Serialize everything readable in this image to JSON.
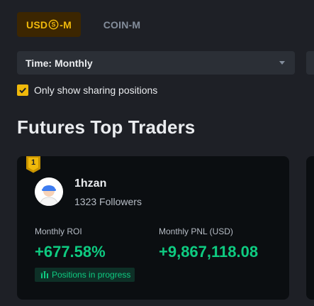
{
  "tabs": [
    {
      "label_prefix": "USD",
      "label_suffix": "-M",
      "icon": "dollar-coin-icon",
      "active": true
    },
    {
      "label": "COIN-M",
      "active": false
    }
  ],
  "filter": {
    "select_value": "Time: Monthly",
    "checkbox_label": "Only show sharing positions",
    "checkbox_checked": true
  },
  "page_title": "Futures Top Traders",
  "card": {
    "rank": "1",
    "name": "1hzan",
    "followers": "1323 Followers",
    "roi_label": "Monthly ROI",
    "roi_value": "+677.58%",
    "pnl_label": "Monthly PNL (USD)",
    "pnl_value": "+9,867,118.08",
    "status": "Positions in progress"
  },
  "colors": {
    "accent": "#f0b90b",
    "positive": "#0ecb81",
    "background": "#1e2026",
    "card": "#0b0e11"
  }
}
